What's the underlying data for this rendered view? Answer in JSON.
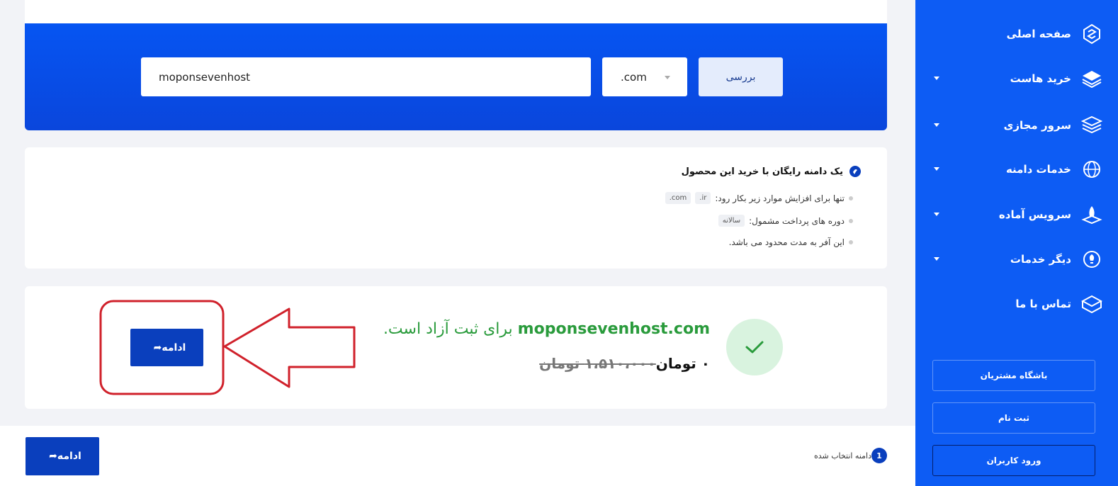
{
  "sidebar": {
    "items": [
      {
        "label": "صفحه اصلی",
        "icon": "home-logo-icon",
        "has_caret": false
      },
      {
        "label": "خرید هاست",
        "icon": "layers-icon",
        "has_caret": true
      },
      {
        "label": "سرور مجازی",
        "icon": "server-stack-icon",
        "has_caret": true
      },
      {
        "label": "خدمات دامنه",
        "icon": "globe-icon",
        "has_caret": true
      },
      {
        "label": "سرویس آماده",
        "icon": "rocket-icon",
        "has_caret": true
      },
      {
        "label": "دیگر خدمات",
        "icon": "lightbulb-icon",
        "has_caret": true
      },
      {
        "label": "تماس با ما",
        "icon": "mail-box-icon",
        "has_caret": false
      }
    ],
    "club_label": "باشگاه مشتریان",
    "register_label": "ثبت نام",
    "login_label": "ورود کاربران"
  },
  "search": {
    "domain_value": "moponsevenhost",
    "tld_value": ".com",
    "check_label": "بررسی"
  },
  "offer": {
    "title": "یک دامنه رایگان با خرید این محصول",
    "line1": "تنها برای افزایش موارد زیر بکار رود:",
    "tags1": [
      ".ir",
      ".com"
    ],
    "line2": "دوره های پرداخت مشمول:",
    "tags2": [
      "سالانه"
    ],
    "line3": "این آفر به مدت محدود می باشد."
  },
  "result": {
    "domain": "moponsevenhost.com",
    "available_text": "برای ثبت آزاد است.",
    "price": "۰ تومان",
    "old_price": "۱،۵۱۰،۰۰۰ تومان",
    "continue_label": "ادامه"
  },
  "footer": {
    "continue_label": "ادامه",
    "selected_count": "1",
    "selected_label": "دامنه انتخاب شده"
  },
  "colors": {
    "sidebar_blue": "#0d5cf4",
    "banner_blue": "#0655f2",
    "button_blue": "#0a3fbd",
    "success_green": "#2a9b3c",
    "annotation_red": "#d0212b"
  }
}
